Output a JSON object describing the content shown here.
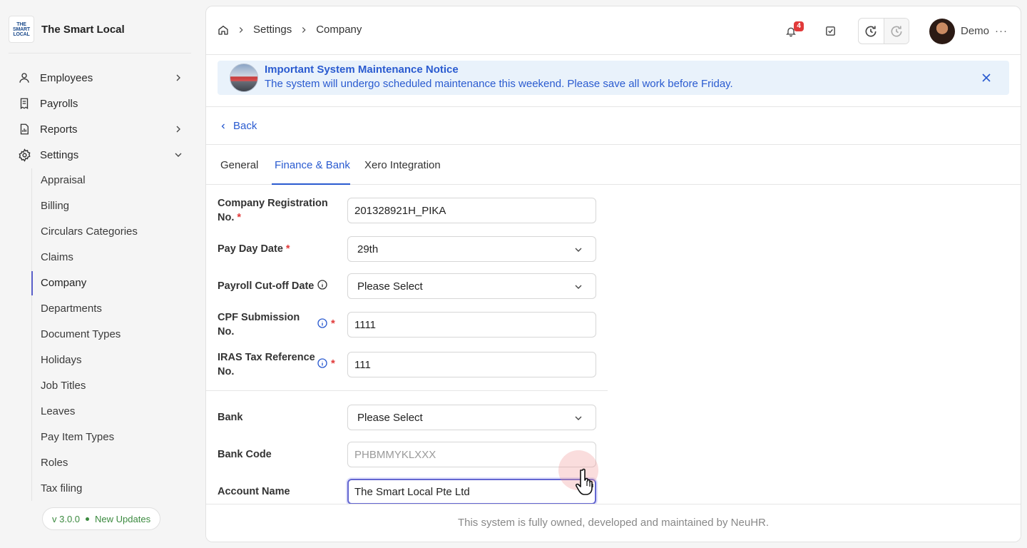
{
  "brand": {
    "name": "The Smart Local",
    "logo_lines": [
      "THE",
      "SMART",
      "LOCAL"
    ]
  },
  "sidebar": {
    "items": [
      {
        "label": "Employees",
        "icon": "user-icon",
        "expandable": true
      },
      {
        "label": "Payrolls",
        "icon": "receipt-icon",
        "expandable": false
      },
      {
        "label": "Reports",
        "icon": "report-icon",
        "expandable": true
      },
      {
        "label": "Settings",
        "icon": "gear-icon",
        "expandable": true,
        "expanded": true
      }
    ],
    "settings_children": [
      "Appraisal",
      "Billing",
      "Circulars Categories",
      "Claims",
      "Company",
      "Departments",
      "Document Types",
      "Holidays",
      "Job Titles",
      "Leaves",
      "Pay Item Types",
      "Roles",
      "Tax filing"
    ],
    "active_child": "Company",
    "version": {
      "number": "v 3.0.0",
      "updates_label": "New Updates"
    }
  },
  "header": {
    "breadcrumb": [
      "Settings",
      "Company"
    ],
    "notification_count": "4",
    "user_name": "Demo",
    "more_label": "···"
  },
  "notice": {
    "title": "Important System Maintenance Notice",
    "text": "The system will undergo scheduled maintenance this weekend. Please save all work before Friday."
  },
  "back_label": "Back",
  "tabs": [
    {
      "label": "General",
      "active": false
    },
    {
      "label": "Finance & Bank",
      "active": true
    },
    {
      "label": "Xero Integration",
      "active": false
    }
  ],
  "form": {
    "company_reg": {
      "label_line1": "Company Registration",
      "label_line2": "No.",
      "value": "201328921H_PIKA",
      "required": true
    },
    "pay_day": {
      "label": "Pay Day Date",
      "value": "29th",
      "required": true
    },
    "payroll_cutoff": {
      "label": "Payroll Cut-off Date",
      "value": "Please Select"
    },
    "cpf": {
      "label_line1": "CPF Submission",
      "label_line2": "No.",
      "value": "1111",
      "required": true
    },
    "iras": {
      "label_line1": "IRAS Tax Reference",
      "label_line2": "No.",
      "value": "111",
      "required": true
    },
    "bank": {
      "label": "Bank",
      "value": "Please Select"
    },
    "bank_code": {
      "label": "Bank Code",
      "placeholder": "PHBMMYKLXXX"
    },
    "account_name": {
      "label": "Account Name",
      "value": "The Smart Local Pte Ltd"
    }
  },
  "footer": {
    "text": "This system is fully owned, developed and maintained by NeuHR."
  },
  "colors": {
    "accent": "#2a5bd0",
    "required": "#e13a3a",
    "notice_bg": "#e9f2fb",
    "focus": "#6366d1",
    "version_green": "#3b8a3f"
  }
}
